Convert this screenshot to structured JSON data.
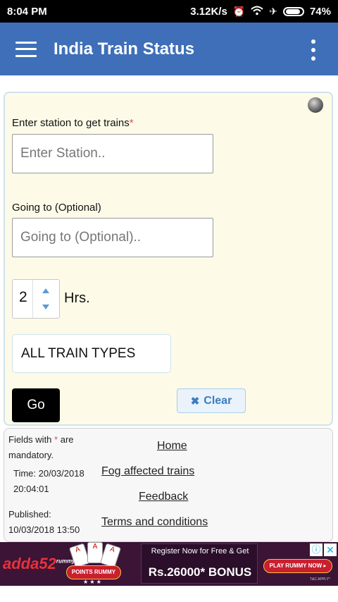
{
  "status_bar": {
    "time": "8:04 PM",
    "speed": "3.12K/s",
    "battery": "74%"
  },
  "app_bar": {
    "title": "India Train Status"
  },
  "form": {
    "station_label": "Enter station to get trains",
    "required_mark": "*",
    "station_placeholder": "Enter Station..",
    "going_label": "Going to (Optional)",
    "going_placeholder": "Going to (Optional)..",
    "hours_value": "2",
    "hours_unit": "Hrs.",
    "train_type": "ALL TRAIN TYPES",
    "go_label": "Go",
    "clear_label": "Clear"
  },
  "info": {
    "mandatory_pre": "Fields with",
    "mandatory_star": "*",
    "mandatory_post": "are",
    "mandatory_line2": "mandatory.",
    "time_line1": "Time: 20/03/2018",
    "time_line2": "20:04:01",
    "published_line1": "Published:",
    "published_line2": "10/03/2018 13:50"
  },
  "links": {
    "home": "Home",
    "fog": "Fog affected trains",
    "feedback": "Feedback",
    "terms": "Terms and conditions"
  },
  "ad": {
    "brand": "adda52",
    "brand_sub": "rummy",
    "badge": "POINTS RUMMY",
    "stars": "★ ★ ★",
    "headline": "Register Now for Free & Get",
    "bonus": "Rs.26000* BONUS",
    "cta": "PLAY RUMMY NOW ▸",
    "tc": "T&C APPLY*"
  }
}
